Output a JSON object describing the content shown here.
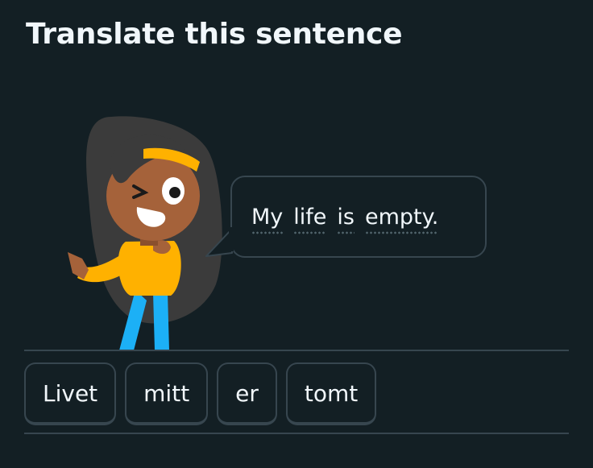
{
  "header": {
    "title": "Translate this sentence"
  },
  "prompt": {
    "character_icon": "character-illustration",
    "words": [
      "My",
      "life",
      "is",
      "empty."
    ]
  },
  "word_bank": {
    "tiles": [
      "Livet",
      "mitt",
      "er",
      "tomt"
    ]
  },
  "colors": {
    "background": "#131f24",
    "border": "#37464f",
    "text": "#f1f7fb",
    "shirt": "#ffb100",
    "pants": "#1cb0f6",
    "skin": "#a5623a",
    "hair": "#3c3c3c"
  }
}
